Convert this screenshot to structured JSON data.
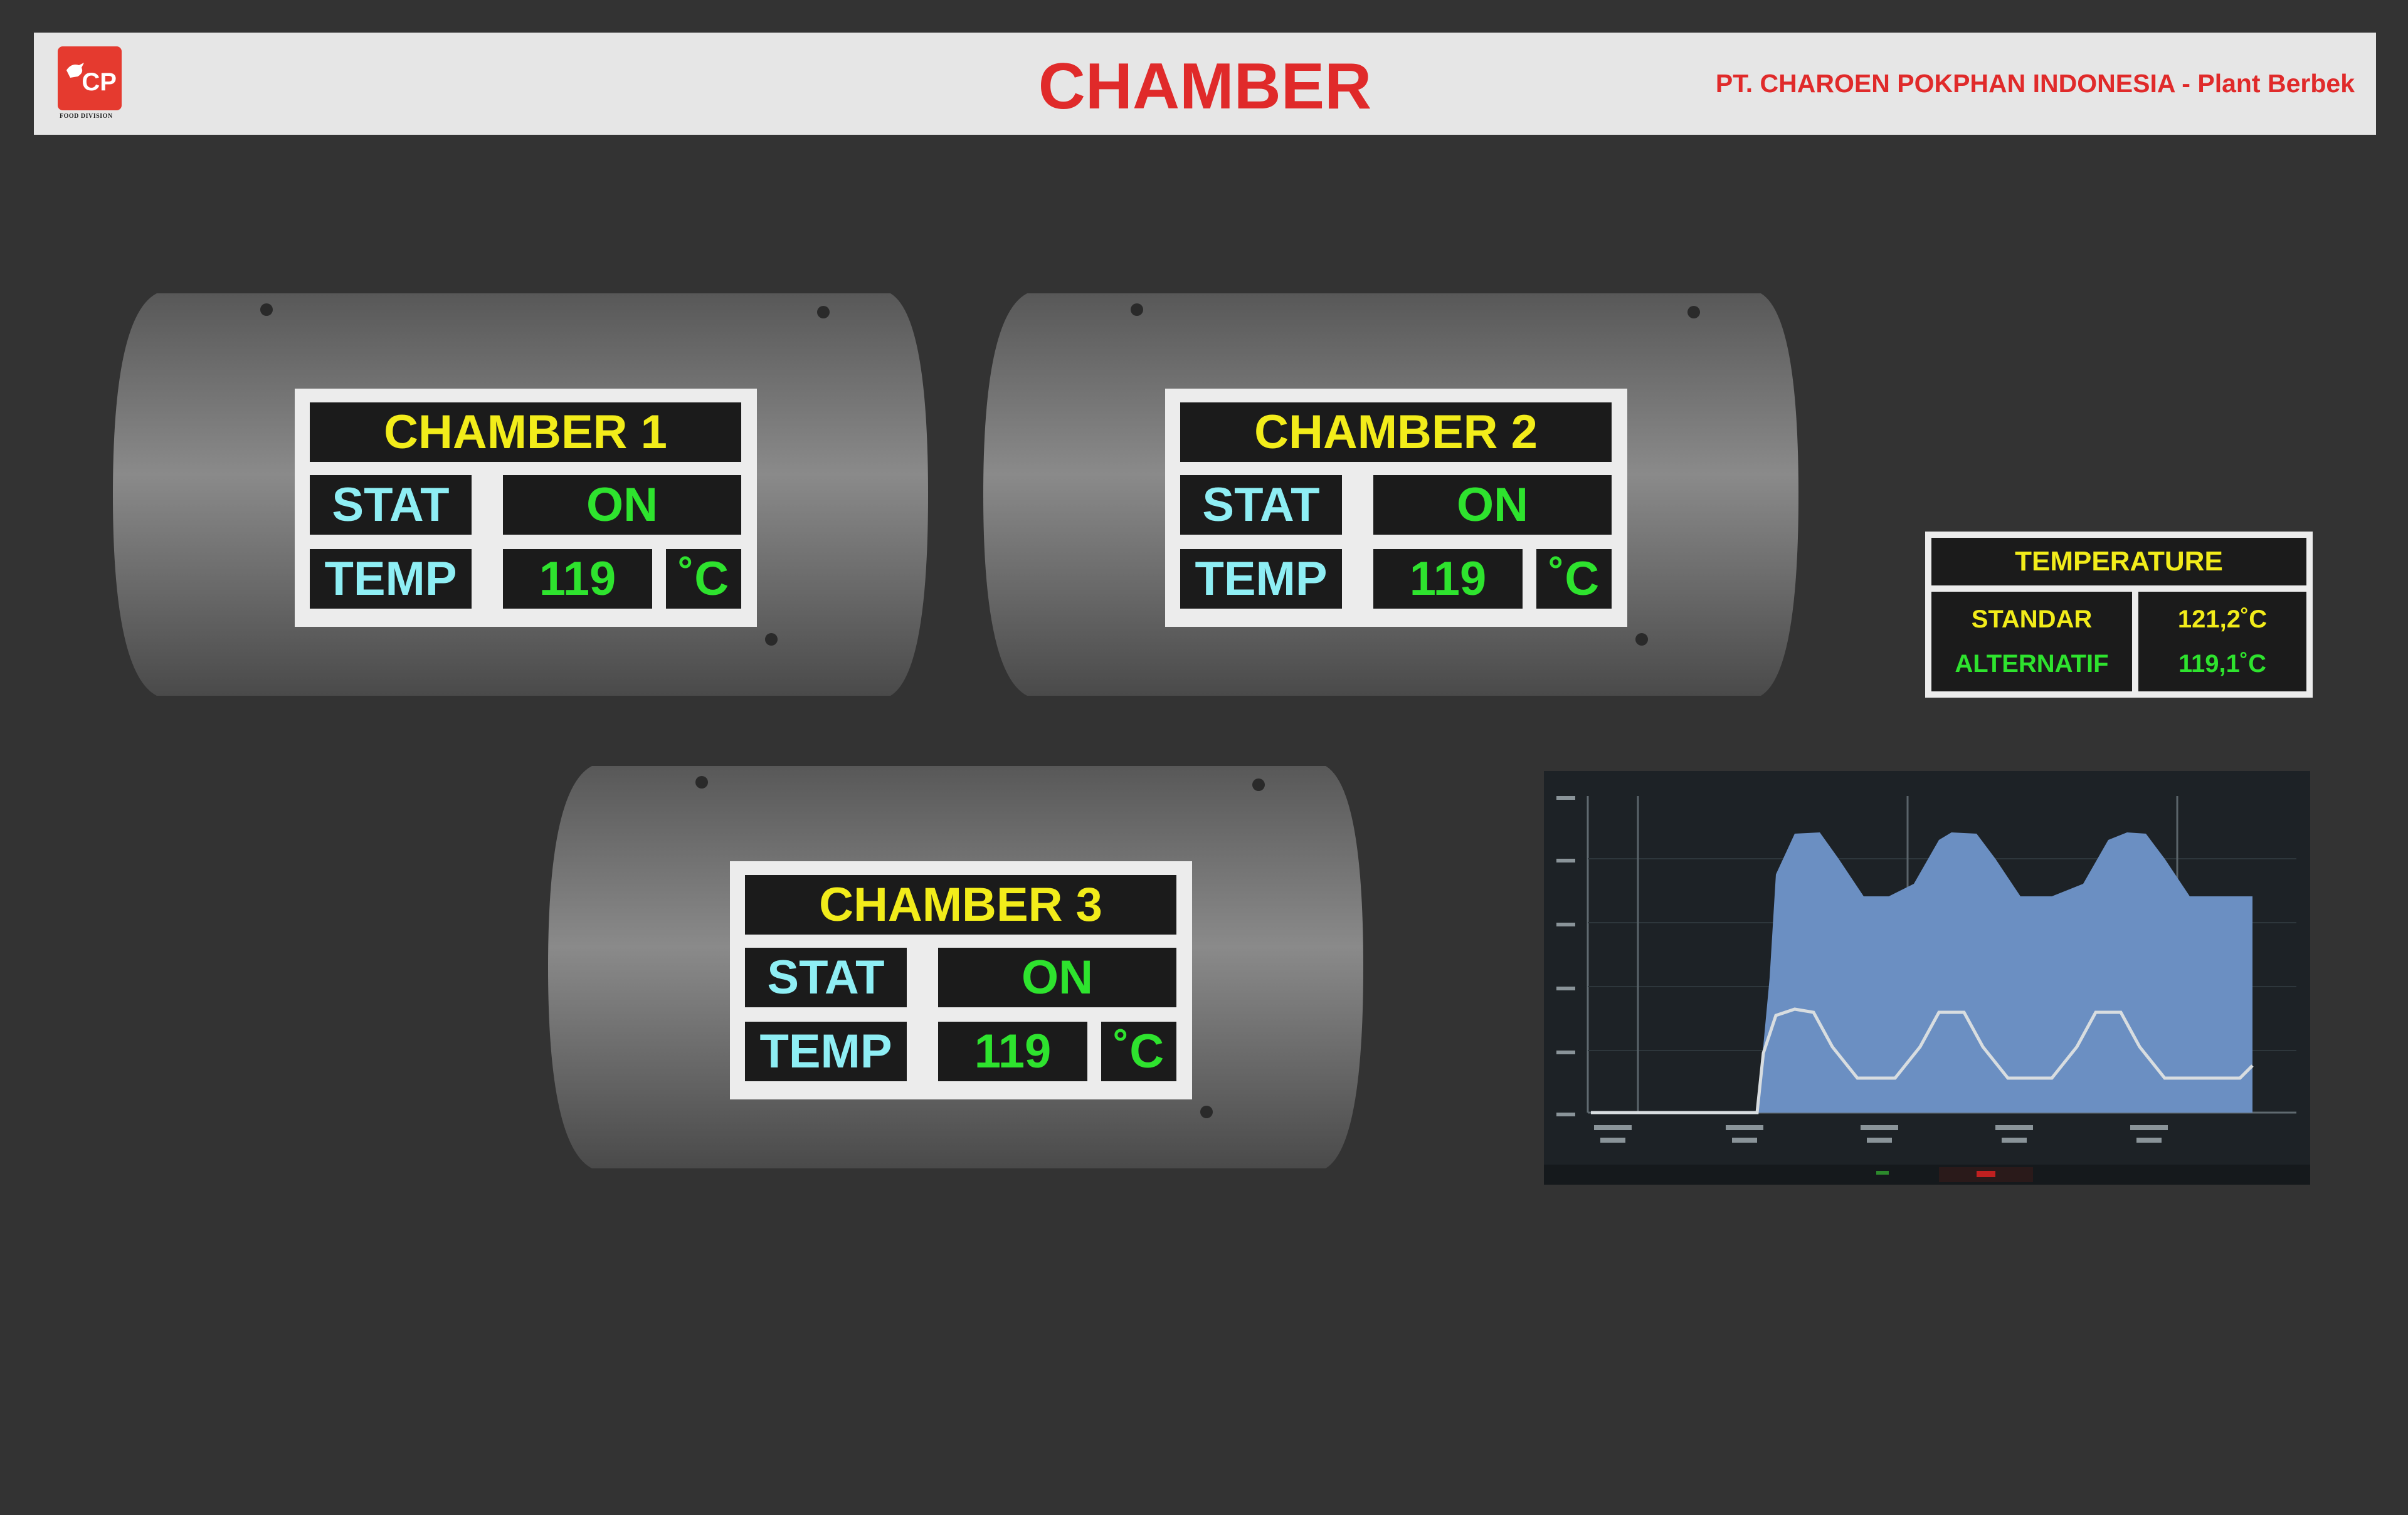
{
  "header": {
    "logo_text": "CP",
    "logo_subtitle": "FOOD DIVISION",
    "title": "CHAMBER",
    "company": "PT. CHAROEN POKPHAN INDONESIA - Plant Berbek"
  },
  "chambers": [
    {
      "name": "CHAMBER 1",
      "stat_label": "STAT",
      "stat_value": "ON",
      "temp_label": "TEMP",
      "temp_value": "119",
      "unit": "˚C"
    },
    {
      "name": "CHAMBER 2",
      "stat_label": "STAT",
      "stat_value": "ON",
      "temp_label": "TEMP",
      "temp_value": "119",
      "unit": "˚C"
    },
    {
      "name": "CHAMBER 3",
      "stat_label": "STAT",
      "stat_value": "ON",
      "temp_label": "TEMP",
      "temp_value": "119",
      "unit": "˚C"
    }
  ],
  "temperature_table": {
    "title": "TEMPERATURE",
    "rows": [
      {
        "label": "STANDAR",
        "value": "121,2˚C"
      },
      {
        "label": "ALTERNATIF",
        "value": "119,1˚C"
      }
    ]
  },
  "colors": {
    "background": "#333333",
    "header_bg": "#e6e6e6",
    "title_red": "#e02a2a",
    "label_yellow": "#f2ec1a",
    "label_cyan": "#8eeef4",
    "value_green": "#2ee32e",
    "chart_area": "#6b8fc2"
  }
}
